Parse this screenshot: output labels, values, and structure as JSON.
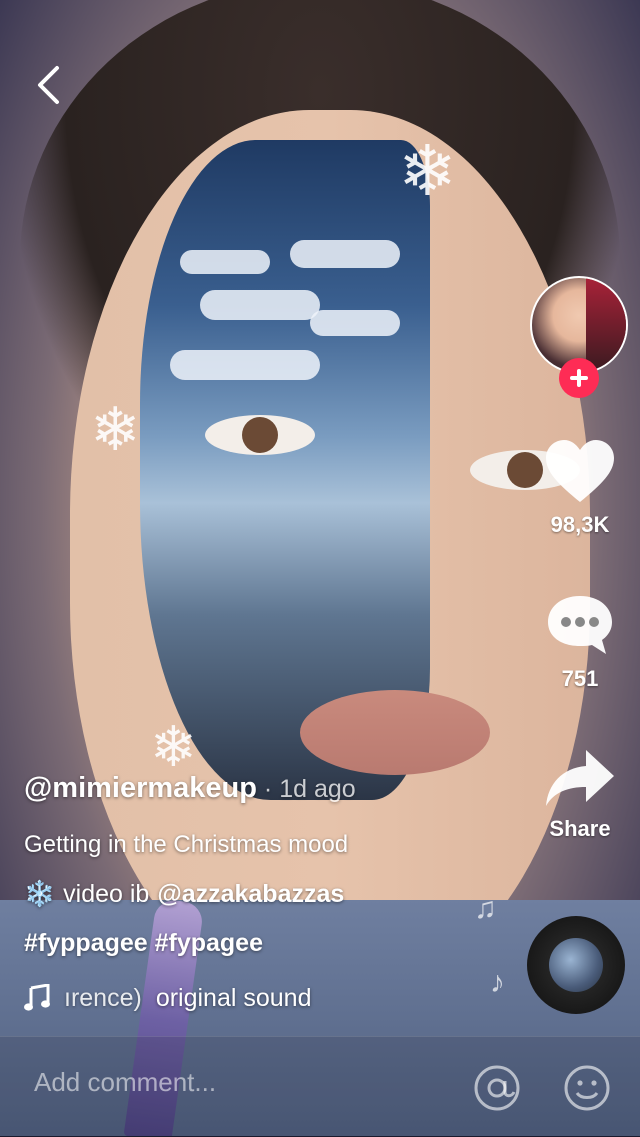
{
  "nav": {
    "back_icon": "chevron-left-icon"
  },
  "creator": {
    "avatar_icon": "profile-avatar",
    "follow_icon": "plus-icon",
    "follow_color": "#fe2c55"
  },
  "actions": {
    "like_count": "98,3K",
    "comment_count": "751",
    "share_label": "Share"
  },
  "post": {
    "username": "@mimiermakeup",
    "time_ago": " · 1d ago",
    "description": "Getting in the Christmas mood",
    "credit_emoji": "❄️",
    "credit_text": "video ib",
    "credit_mention": "@azzakabazzas",
    "hashtags": "#fyppagee #fypagee",
    "sound_prefix": "ırence)",
    "sound_name": "original sound"
  },
  "comment_bar": {
    "placeholder": "Add comment..."
  }
}
